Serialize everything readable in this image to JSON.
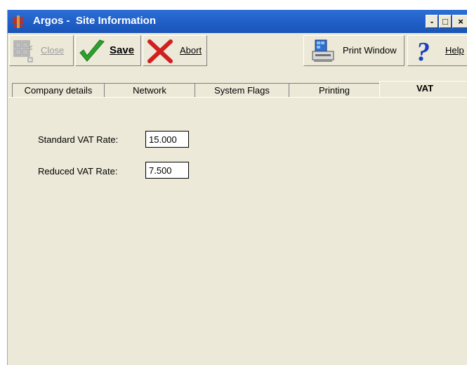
{
  "window": {
    "title": "Argos -  Site Information",
    "minimize": "-",
    "maximize": "□",
    "close": "×"
  },
  "toolbar": {
    "close_label": "Close",
    "save_label": "Save",
    "abort_label": "Abort",
    "print_label": "Print Window",
    "help_label": "Help"
  },
  "tabs": [
    {
      "label": "Company details"
    },
    {
      "label": "Network"
    },
    {
      "label": "System Flags"
    },
    {
      "label": "Printing"
    },
    {
      "label": "VAT"
    }
  ],
  "active_tab": "VAT",
  "vat": {
    "standard_label": "Standard VAT Rate:",
    "standard_value": "15.000",
    "reduced_label": "Reduced VAT Rate:",
    "reduced_value": "7.500"
  },
  "colors": {
    "titlebar": "#2060c8",
    "save_check": "#2ea02e",
    "abort_cross": "#d02020",
    "help": "#1840c0"
  }
}
